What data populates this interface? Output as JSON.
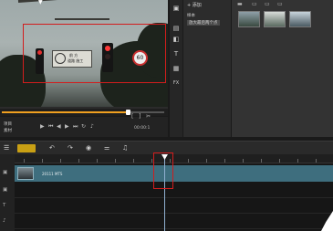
{
  "preview": {
    "sign_text_line1": "前 方 ",
    "sign_text_line2": "道路 施工 ",
    "speed_sign": "60",
    "timecode": "00:00:1",
    "mode_label_1": "项目",
    "mode_label_2": "素材"
  },
  "library": {
    "add_label": "添加",
    "items": [
      "样本",
      "放大最后两个点"
    ]
  },
  "timeline": {
    "clip_name": "20111 MTS"
  }
}
